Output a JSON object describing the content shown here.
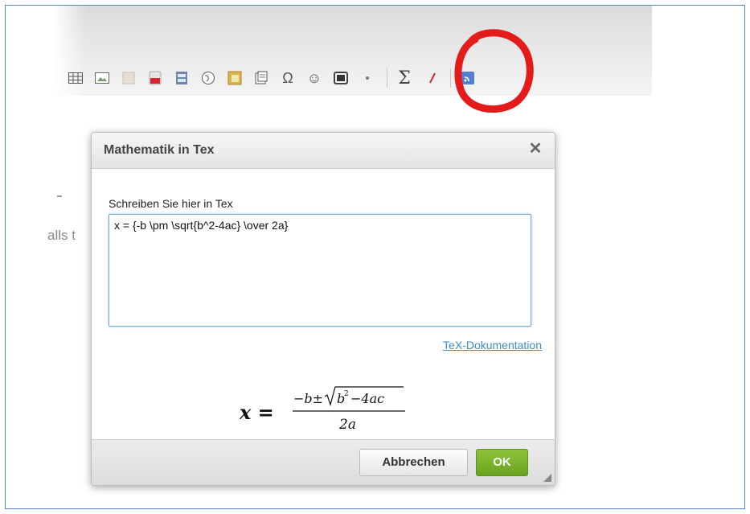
{
  "toolbar": {
    "icons": [
      "table-icon",
      "image-icon",
      "flash-icon",
      "youtube-icon",
      "filmstrip-icon",
      "globe-icon",
      "gallery-icon",
      "template-icon",
      "omega-icon",
      "smiley-icon",
      "media-icon",
      "dot-icon",
      "sigma-icon",
      "tick-icon",
      "rss-icon"
    ],
    "sigma_glyph": "Σ",
    "omega_glyph": "Ω",
    "smiley_glyph": "☺",
    "highlight_color": "#e41b1b"
  },
  "background": {
    "partial_text": "alls t"
  },
  "dialog": {
    "title": "Mathematik in Tex",
    "close_glyph": "✕",
    "input_label": "Schreiben Sie hier in Tex",
    "tex_value": "x = {-b \\pm \\sqrt{b^2-4ac} \\over 2a}",
    "doc_link": "TeX-Dokumentation",
    "preview": {
      "lhs": "x =",
      "numerator_minus_b": "−b±",
      "sqrt_content": "b",
      "exponent": "2",
      "sqrt_rest": "−4ac",
      "denominator": "2a"
    },
    "cancel_label": "Abbrechen",
    "ok_label": "OK",
    "accent_color": "#7ab52b",
    "link_color": "#3a8fc7"
  }
}
